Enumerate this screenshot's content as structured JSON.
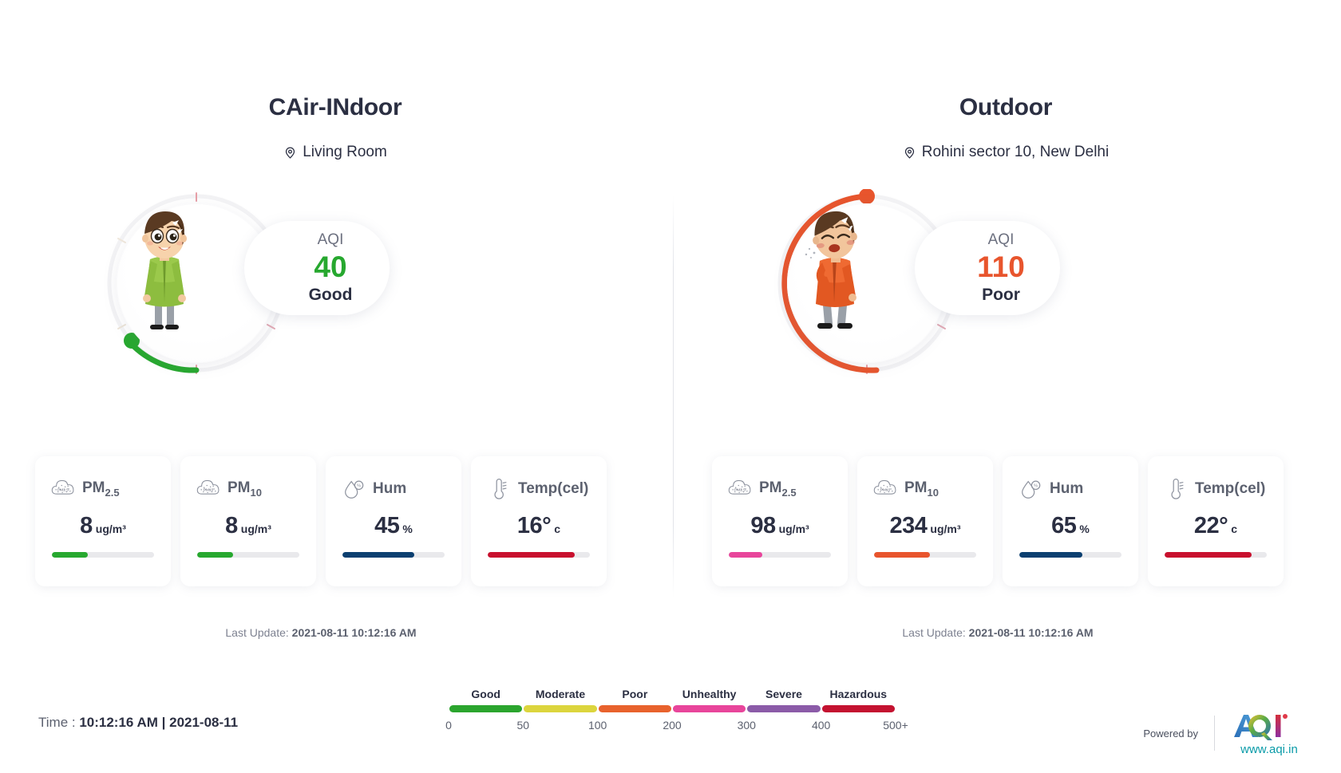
{
  "indoor": {
    "title": "CAir-INdoor",
    "location": "Living Room",
    "location_icon": "map-pin-icon",
    "aqi_label": "AQI",
    "aqi_value": "40",
    "aqi_status": "Good",
    "aqi_color": "#27a82f",
    "arc_color": "#27a82f",
    "arc_percent": 8,
    "avatar": "happy-boy-green-kurta",
    "last_update_prefix": "Last Update: ",
    "last_update_value": "2021-08-11 10:12:16 AM",
    "cards": [
      {
        "name": "pm25",
        "icon": "pm25-cloud-icon",
        "title": "PM",
        "sub": "2.5",
        "value": "8",
        "unit": "ug/m³",
        "bar_color": "#27a82f",
        "bar_percent": 35
      },
      {
        "name": "pm10",
        "icon": "pm10-cloud-icon",
        "title": "PM",
        "sub": "10",
        "value": "8",
        "unit": "ug/m³",
        "bar_color": "#27a82f",
        "bar_percent": 35
      },
      {
        "name": "humidity",
        "icon": "humidity-droplet-icon",
        "title": "Hum",
        "sub": "",
        "value": "45",
        "unit": "%",
        "bar_color": "#0b3f70",
        "bar_percent": 70
      },
      {
        "name": "temperature",
        "icon": "thermometer-icon",
        "title": "Temp(cel)",
        "sub": "",
        "value": "16°",
        "unit": "c",
        "bar_color": "#c8102e",
        "bar_percent": 85
      }
    ]
  },
  "outdoor": {
    "title": "Outdoor",
    "location": "Rohini sector 10, New Delhi",
    "location_icon": "map-pin-icon",
    "aqi_label": "AQI",
    "aqi_value": "110",
    "aqi_status": "Poor",
    "aqi_color": "#e8552d",
    "arc_color": "#e8552d",
    "arc_percent": 86,
    "avatar": "coughing-boy-orange-kurta",
    "last_update_prefix": "Last Update: ",
    "last_update_value": "2021-08-11 10:12:16 AM",
    "cards": [
      {
        "name": "pm25",
        "icon": "pm25-cloud-icon",
        "title": "PM",
        "sub": "2.5",
        "value": "98",
        "unit": "ug/m³",
        "bar_color": "#e8459b",
        "bar_percent": 33
      },
      {
        "name": "pm10",
        "icon": "pm10-cloud-icon",
        "title": "PM",
        "sub": "10",
        "value": "234",
        "unit": "ug/m³",
        "bar_color": "#e8552d",
        "bar_percent": 55
      },
      {
        "name": "humidity",
        "icon": "humidity-droplet-icon",
        "title": "Hum",
        "sub": "",
        "value": "65",
        "unit": "%",
        "bar_color": "#0b3f70",
        "bar_percent": 62
      },
      {
        "name": "temperature",
        "icon": "thermometer-icon",
        "title": "Temp(cel)",
        "sub": "",
        "value": "22°",
        "unit": "c",
        "bar_color": "#c8102e",
        "bar_percent": 85
      }
    ]
  },
  "legend": {
    "categories": [
      {
        "label": "Good",
        "color": "#2ba52e"
      },
      {
        "label": "Moderate",
        "color": "#dcd53d"
      },
      {
        "label": "Poor",
        "color": "#e8622d"
      },
      {
        "label": "Unhealthy",
        "color": "#e8459b"
      },
      {
        "label": "Severe",
        "color": "#8b5ba8"
      },
      {
        "label": "Hazardous",
        "color": "#c41230"
      }
    ],
    "ticks": [
      "0",
      "50",
      "100",
      "200",
      "300",
      "400",
      "500+"
    ]
  },
  "footer": {
    "time_label": "Time : ",
    "time_value": "10:12:16 AM | 2021-08-11",
    "powered_by": "Powered by",
    "logo_text": "AQI",
    "logo_url": "www.aqi.in"
  }
}
